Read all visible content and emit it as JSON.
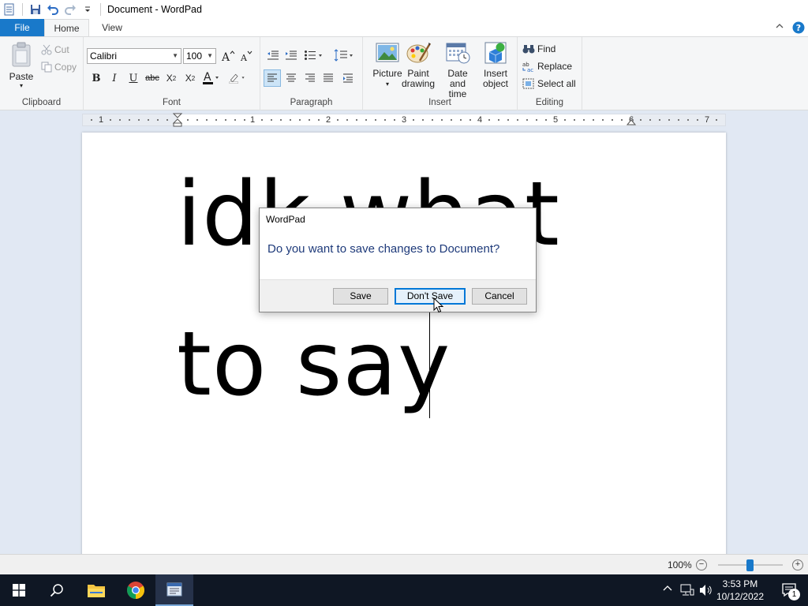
{
  "window": {
    "title": "Document - WordPad"
  },
  "tabs": [
    {
      "label": "File"
    },
    {
      "label": "Home"
    },
    {
      "label": "View"
    }
  ],
  "ribbon": {
    "clipboard": {
      "label": "Clipboard",
      "paste": "Paste",
      "cut": "Cut",
      "copy": "Copy"
    },
    "font": {
      "label": "Font",
      "family": "Calibri",
      "size": "100"
    },
    "paragraph": {
      "label": "Paragraph"
    },
    "insert": {
      "label": "Insert",
      "picture": "Picture",
      "paint_l1": "Paint",
      "paint_l2": "drawing",
      "datetime_l1": "Date and",
      "datetime_l2": "time",
      "object_l1": "Insert",
      "object_l2": "object"
    },
    "editing": {
      "label": "Editing",
      "find": "Find",
      "replace": "Replace",
      "select_all": "Select all"
    }
  },
  "ruler": {
    "numbers": [
      "1",
      "1",
      "2",
      "3",
      "4",
      "5",
      "6",
      "7"
    ]
  },
  "document": {
    "lines": [
      "idk what",
      "to say"
    ]
  },
  "dialog": {
    "title": "WordPad",
    "message": "Do you want to save changes to Document?",
    "save": "Save",
    "dont_save": "Don't Save",
    "cancel": "Cancel"
  },
  "status": {
    "zoom": "100%"
  },
  "taskbar": {
    "time": "3:53 PM",
    "date": "10/12/2022",
    "notifications": "1"
  },
  "colors": {
    "accent": "#1979ca",
    "ribbon_bg": "#f5f6f7",
    "workspace_bg": "#e1e8f3",
    "taskbar_bg": "#0f1724"
  }
}
